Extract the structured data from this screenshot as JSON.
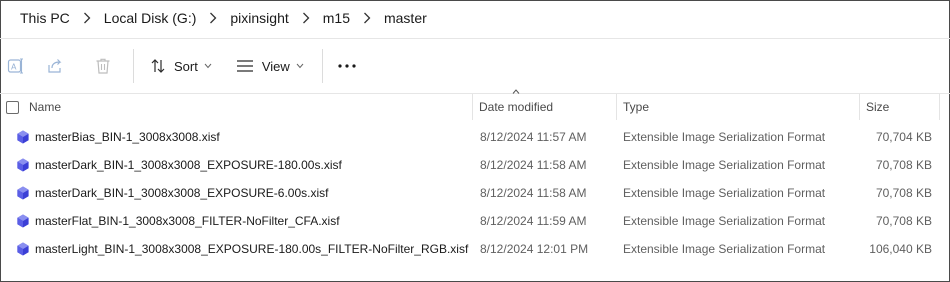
{
  "breadcrumb": [
    "This PC",
    "Local Disk (G:)",
    "pixinsight",
    "m15",
    "master"
  ],
  "toolbar": {
    "sort_label": "Sort",
    "view_label": "View",
    "more_label": "..."
  },
  "columns": {
    "name": "Name",
    "date": "Date modified",
    "type": "Type",
    "size": "Size"
  },
  "files": [
    {
      "name": "masterBias_BIN-1_3008x3008.xisf",
      "date": "8/12/2024 11:57 AM",
      "type": "Extensible Image Serialization Format",
      "size": "70,704 KB"
    },
    {
      "name": "masterDark_BIN-1_3008x3008_EXPOSURE-180.00s.xisf",
      "date": "8/12/2024 11:58 AM",
      "type": "Extensible Image Serialization Format",
      "size": "70,708 KB"
    },
    {
      "name": "masterDark_BIN-1_3008x3008_EXPOSURE-6.00s.xisf",
      "date": "8/12/2024 11:58 AM",
      "type": "Extensible Image Serialization Format",
      "size": "70,708 KB"
    },
    {
      "name": "masterFlat_BIN-1_3008x3008_FILTER-NoFilter_CFA.xisf",
      "date": "8/12/2024 11:59 AM",
      "type": "Extensible Image Serialization Format",
      "size": "70,708 KB"
    },
    {
      "name": "masterLight_BIN-1_3008x3008_EXPOSURE-180.00s_FILTER-NoFilter_RGB.xisf",
      "date": "8/12/2024 12:01 PM",
      "type": "Extensible Image Serialization Format",
      "size": "106,040 KB"
    }
  ],
  "icons": {
    "chevron": "chevron-right-icon",
    "rename": "rename-icon",
    "share": "share-icon",
    "delete": "delete-icon",
    "sort": "sort-icon",
    "view": "view-icon",
    "more": "more-icon",
    "file": "xisf-file-icon"
  },
  "colors": {
    "file_icon": "#3b3fd6",
    "file_icon_light": "#8a8ff0",
    "disabled_icon": "#9ab4d6"
  }
}
